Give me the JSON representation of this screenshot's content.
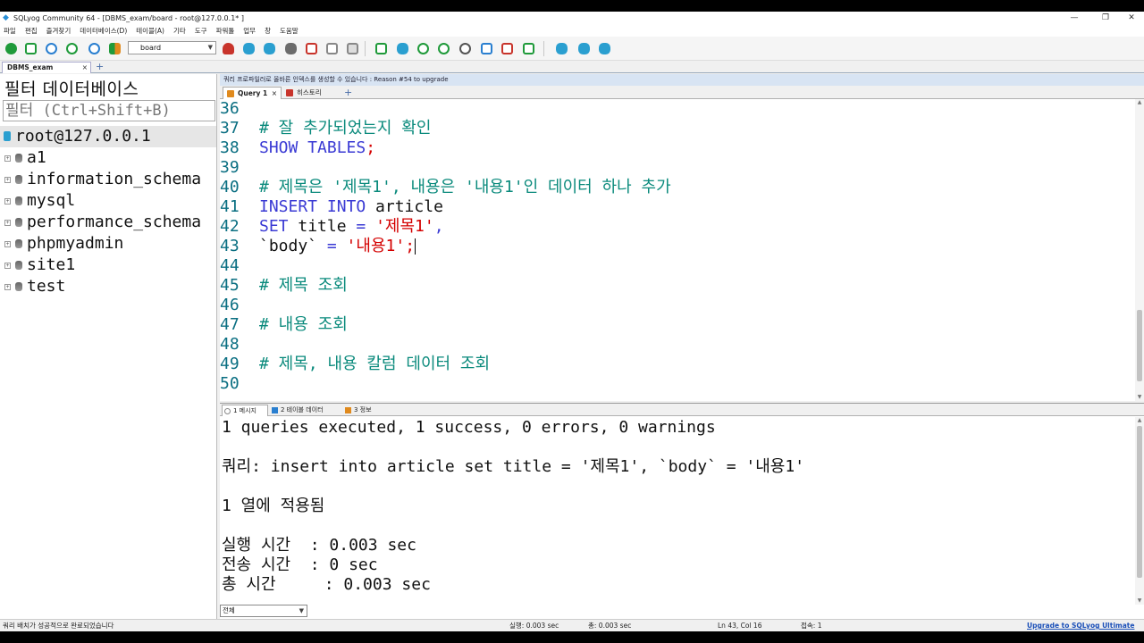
{
  "window": {
    "title": "SQLyog Community 64 - [DBMS_exam/board - root@127.0.0.1* ]",
    "minimize": "—",
    "restore": "❐",
    "close": "✕"
  },
  "menu": [
    "파일",
    "편집",
    "즐겨찾기",
    "데이터베이스(D)",
    "테이블(A)",
    "기타",
    "도구",
    "파워툴",
    "업무",
    "창",
    "도움말"
  ],
  "toolbar": {
    "database_selected": "board",
    "icon_colors": {
      "green": "#1f9a3a",
      "teal": "#2a9fd0",
      "gray": "#6b6b6b",
      "orange": "#e08a1e",
      "red": "#c8342b"
    }
  },
  "connection_tab": {
    "label": "DBMS_exam",
    "close": "×",
    "add": "+"
  },
  "object_browser": {
    "header": "필터 데이터베이스",
    "filter_placeholder": "필터 (Ctrl+Shift+B)",
    "root": "root@127.0.0.1",
    "databases": [
      "a1",
      "information_schema",
      "mysql",
      "performance_schema",
      "phpmyadmin",
      "site1",
      "test"
    ]
  },
  "editor": {
    "notice": "쿼리 프로파일러로 올바른 인덱스를 생성할 수 있습니다 : Reason #54 to upgrade",
    "tabs": {
      "query": "Query 1",
      "query_close": "×",
      "history": "히스토리",
      "add": "+"
    },
    "lines": [
      {
        "n": "36",
        "tokens": []
      },
      {
        "n": "37",
        "tokens": [
          {
            "t": "# 잘 추가되었는지 확인",
            "c": "cm"
          }
        ]
      },
      {
        "n": "38",
        "tokens": [
          {
            "t": "SHOW TABLES",
            "c": "kw"
          },
          {
            "t": ";",
            "c": "str"
          }
        ]
      },
      {
        "n": "39",
        "tokens": []
      },
      {
        "n": "40",
        "tokens": [
          {
            "t": "# 제목은 '제목1', 내용은 '내용1'인 데이터 하나 추가",
            "c": "cm"
          }
        ]
      },
      {
        "n": "41",
        "tokens": [
          {
            "t": "INSERT INTO ",
            "c": "kw"
          },
          {
            "t": "article",
            "c": "id"
          }
        ]
      },
      {
        "n": "42",
        "tokens": [
          {
            "t": "SET ",
            "c": "kw"
          },
          {
            "t": "title ",
            "c": "id"
          },
          {
            "t": "= ",
            "c": "kw"
          },
          {
            "t": "'제목1'",
            "c": "str"
          },
          {
            "t": ",",
            "c": "kw"
          }
        ]
      },
      {
        "n": "43",
        "tokens": [
          {
            "t": "`body` ",
            "c": "id"
          },
          {
            "t": "= ",
            "c": "kw"
          },
          {
            "t": "'내용1'",
            "c": "str"
          },
          {
            "t": ";",
            "c": "str"
          }
        ],
        "caret": true
      },
      {
        "n": "44",
        "tokens": []
      },
      {
        "n": "45",
        "tokens": [
          {
            "t": "# 제목 조회",
            "c": "cm"
          }
        ]
      },
      {
        "n": "46",
        "tokens": []
      },
      {
        "n": "47",
        "tokens": [
          {
            "t": "# 내용 조회",
            "c": "cm"
          }
        ]
      },
      {
        "n": "48",
        "tokens": []
      },
      {
        "n": "49",
        "tokens": [
          {
            "t": "# 제목, 내용 칼럼 데이터 조회",
            "c": "cm"
          }
        ]
      },
      {
        "n": "50",
        "tokens": []
      }
    ]
  },
  "results": {
    "tabs": {
      "messages": "1 메시지",
      "table_data": "2 테이블 데이터",
      "info": "3 정보"
    },
    "lines": [
      "1 queries executed, 1 success, 0 errors, 0 warnings",
      "",
      "쿼리: insert into article set title = '제목1', `body` = '내용1'",
      "",
      "1 열에 적용됨",
      "",
      "실행 시간  : 0.003 sec",
      "전송 시간  : 0 sec",
      "총 시간     : 0.003 sec"
    ],
    "filter": "전체"
  },
  "status": {
    "message": "쿼리 배치가 성공적으로 완료되었습니다",
    "exec": "실행: 0.003 sec",
    "total": "총: 0.003 sec",
    "position": "Ln 43, Col 16",
    "connections": "접속: 1",
    "upgrade": "Upgrade to SQLyog Ultimate"
  }
}
